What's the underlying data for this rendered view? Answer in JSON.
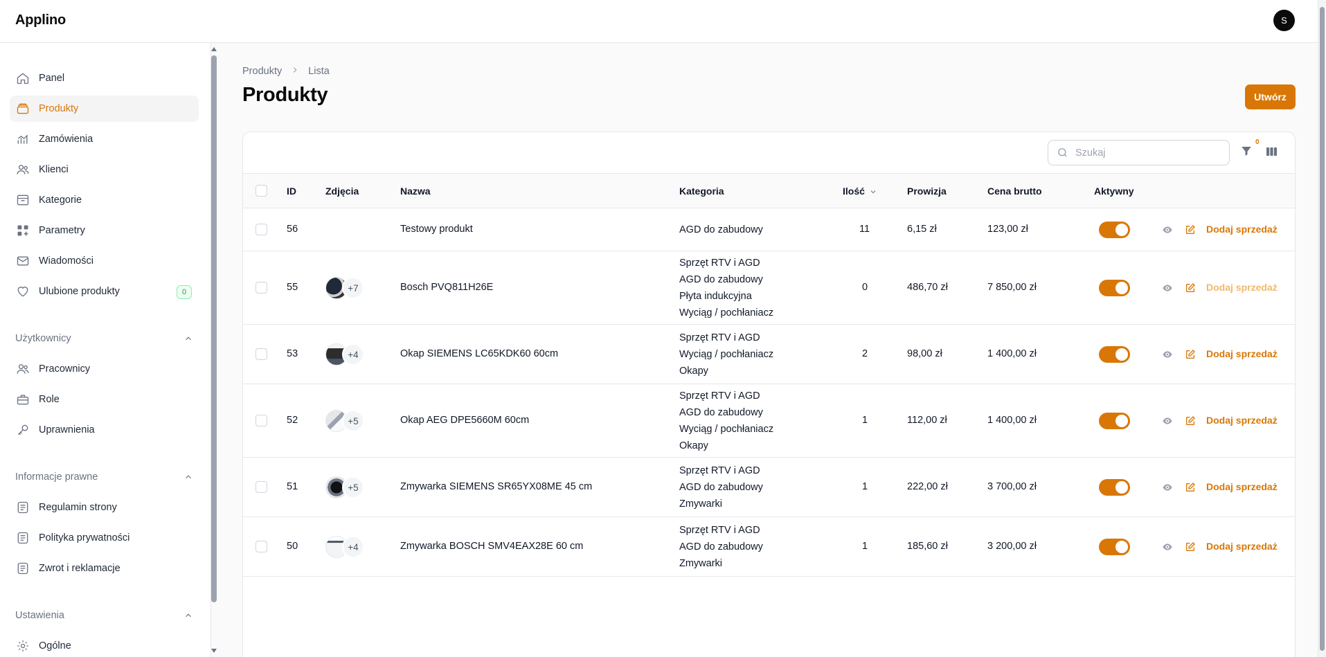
{
  "app": {
    "title": "Applino",
    "user_initial": "S"
  },
  "sidebar": {
    "items": [
      {
        "label": "Panel",
        "icon": "home-icon"
      },
      {
        "label": "Produkty",
        "icon": "box-icon"
      },
      {
        "label": "Zamówienia",
        "icon": "chart-icon"
      },
      {
        "label": "Klienci",
        "icon": "users-icon"
      },
      {
        "label": "Kategorie",
        "icon": "archive-icon"
      },
      {
        "label": "Parametry",
        "icon": "squares-plus-icon"
      },
      {
        "label": "Wiadomości",
        "icon": "envelope-icon"
      },
      {
        "label": "Ulubione produkty",
        "icon": "heart-icon",
        "badge": "0"
      }
    ],
    "groups": [
      {
        "label": "Użytkownicy",
        "items": [
          {
            "label": "Pracownicy",
            "icon": "users-icon"
          },
          {
            "label": "Role",
            "icon": "briefcase-icon"
          },
          {
            "label": "Uprawnienia",
            "icon": "key-icon"
          }
        ]
      },
      {
        "label": "Informacje prawne",
        "items": [
          {
            "label": "Regulamin strony",
            "icon": "document-icon"
          },
          {
            "label": "Polityka prywatności",
            "icon": "document-icon"
          },
          {
            "label": "Zwrot i reklamacje",
            "icon": "document-icon"
          }
        ]
      },
      {
        "label": "Ustawienia",
        "items": [
          {
            "label": "Ogólne",
            "icon": "gear-icon"
          }
        ]
      }
    ]
  },
  "breadcrumb": [
    "Produkty",
    "Lista"
  ],
  "page": {
    "title": "Produkty",
    "create_label": "Utwórz"
  },
  "toolbar": {
    "search_placeholder": "Szukaj",
    "filter_count": "0"
  },
  "table": {
    "headers": [
      "ID",
      "Zdjęcia",
      "Nazwa",
      "Kategoria",
      "Ilość",
      "Prowizja",
      "Cena brutto",
      "Aktywny"
    ],
    "sale_label": "Dodaj sprzedaż",
    "rows": [
      {
        "id": "56",
        "images": [],
        "more": "",
        "name": "Testowy produkt",
        "categories": [
          "AGD do zabudowy"
        ],
        "qty": "11",
        "commission": "6,15 zł",
        "price": "123,00 zł",
        "active": true
      },
      {
        "id": "55",
        "images": [
          "dark"
        ],
        "more": "+7",
        "name": "Bosch PVQ811H26E",
        "categories": [
          "Sprzęt RTV i AGD",
          "AGD do zabudowy",
          "Płyta indukcyjna",
          "Wyciąg / pochłaniacz"
        ],
        "qty": "0",
        "commission": "486,70 zł",
        "price": "7 850,00 zł",
        "active": true
      },
      {
        "id": "53",
        "images": [
          "hood"
        ],
        "more": "+4",
        "name": "Okap SIEMENS LC65KDK60 60cm",
        "categories": [
          "Sprzęt RTV i AGD",
          "Wyciąg / pochłaniacz",
          "Okapy"
        ],
        "qty": "2",
        "commission": "98,00 zł",
        "price": "1 400,00 zł",
        "active": true
      },
      {
        "id": "52",
        "images": [
          "steel"
        ],
        "more": "+5",
        "name": "Okap AEG DPE5660M 60cm",
        "categories": [
          "Sprzęt RTV i AGD",
          "AGD do zabudowy",
          "Wyciąg / pochłaniacz",
          "Okapy"
        ],
        "qty": "1",
        "commission": "112,00 zł",
        "price": "1 400,00 zł",
        "active": true
      },
      {
        "id": "51",
        "images": [
          "dw"
        ],
        "more": "+5",
        "name": "Zmywarka SIEMENS SR65YX08ME 45 cm",
        "categories": [
          "Sprzęt RTV i AGD",
          "AGD do zabudowy",
          "Zmywarki"
        ],
        "qty": "1",
        "commission": "222,00 zł",
        "price": "3 700,00 zł",
        "active": true
      },
      {
        "id": "50",
        "images": [
          "dw2"
        ],
        "more": "+4",
        "name": "Zmywarka BOSCH SMV4EAX28E 60 cm",
        "categories": [
          "Sprzęt RTV i AGD",
          "AGD do zabudowy",
          "Zmywarki"
        ],
        "qty": "1",
        "commission": "185,60 zł",
        "price": "3 200,00 zł",
        "active": true
      }
    ]
  },
  "colors": {
    "accent": "#d97706",
    "badge_green": "#16a34a"
  }
}
